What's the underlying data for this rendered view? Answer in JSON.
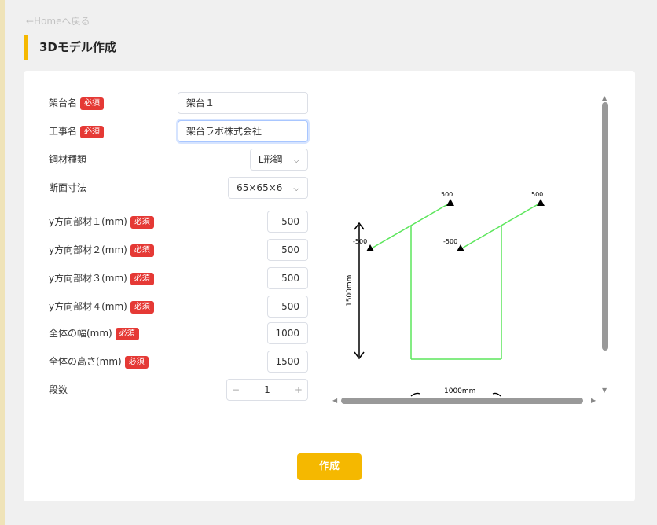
{
  "nav": {
    "back_link": "←Homeへ戻る"
  },
  "page_title": "3Dモデル作成",
  "required_badge": "必須",
  "form": {
    "stand_name": {
      "label": "架台名",
      "value": "架台１"
    },
    "project_name": {
      "label": "工事名",
      "value": "架台ラボ株式会社"
    },
    "steel_type": {
      "label": "鋼材種類",
      "value": "L形鋼"
    },
    "section_size": {
      "label": "断面寸法",
      "value": "65×65×6"
    },
    "y_member_1": {
      "label": "y方向部材１(mm)",
      "value": "500"
    },
    "y_member_2": {
      "label": "y方向部材２(mm)",
      "value": "500"
    },
    "y_member_3": {
      "label": "y方向部材３(mm)",
      "value": "500"
    },
    "y_member_4": {
      "label": "y方向部材４(mm)",
      "value": "500"
    },
    "total_width": {
      "label": "全体の幅(mm)",
      "value": "1000"
    },
    "total_height": {
      "label": "全体の高さ(mm)",
      "value": "1500"
    },
    "stages": {
      "label": "段数",
      "value": "1",
      "minus": "−",
      "plus": "+"
    }
  },
  "preview": {
    "left_top_label": "500",
    "left_side_label": "-500",
    "right_top_label": "500",
    "right_side_label": "-500",
    "height_dim": "1500mm",
    "width_dim": "1000mm",
    "line_color": "#5ce65c"
  },
  "submit_label": "作成",
  "colors": {
    "accent": "#f5b800",
    "required": "#e53935"
  }
}
